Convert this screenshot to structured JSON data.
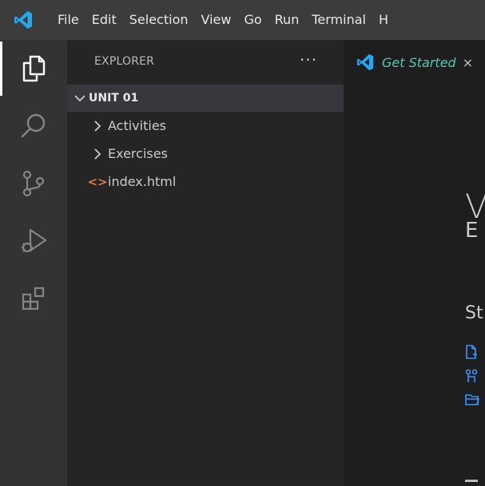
{
  "titlebar": {
    "menu": [
      "File",
      "Edit",
      "Selection",
      "View",
      "Go",
      "Run",
      "Terminal",
      "H"
    ]
  },
  "activity_bar": {
    "items": [
      "explorer-icon",
      "search-icon",
      "source-control-icon",
      "run-debug-icon",
      "extensions-icon"
    ],
    "active": "explorer-icon"
  },
  "sidebar": {
    "title": "EXPLORER",
    "more": "···",
    "folder": "UNIT 01",
    "items": [
      "Activities",
      "Exercises"
    ],
    "file": "index.html",
    "file_icon": "<>"
  },
  "tab": {
    "label": "Get Started",
    "close": "×"
  },
  "welcome": {
    "title": "V",
    "subtitle": "E",
    "start_heading": "St"
  },
  "colors": {
    "accent": "#4ec9b0",
    "vscode_blue": "#23a9f2",
    "start_link_blue": "#3794ff",
    "file_icon_orange": "#e37933"
  }
}
